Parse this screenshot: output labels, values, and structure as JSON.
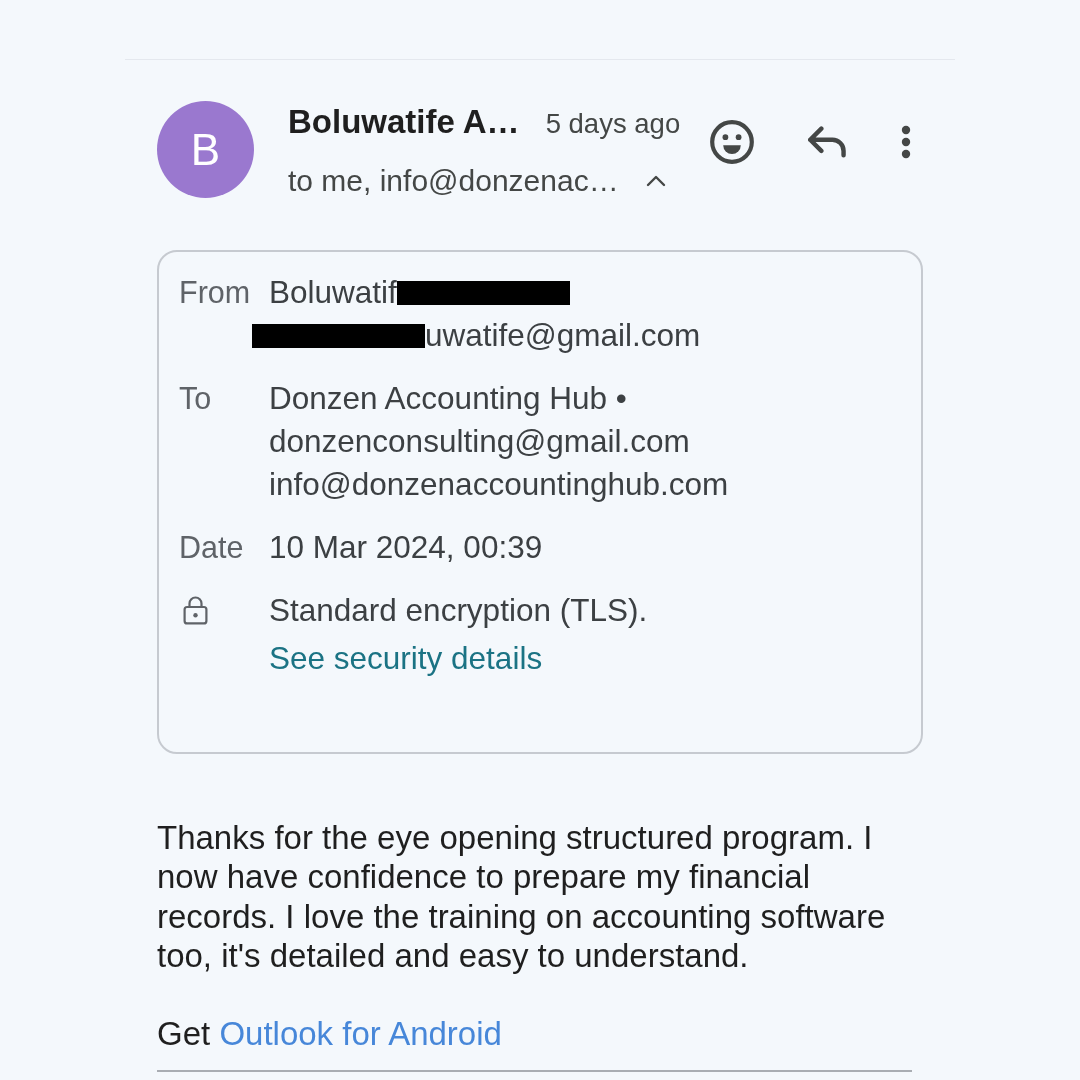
{
  "header": {
    "avatar_letter": "B",
    "sender": "Boluwatife A…",
    "time": "5 days ago",
    "recipients": "to me, info@donzenac…",
    "details_expanded": true
  },
  "details": {
    "rows": [
      {
        "kind": "field",
        "label": "From",
        "lines": [
          {
            "text": "Boluwatif",
            "redacted_start": false,
            "redacted_end": true
          },
          {
            "text": "uwatife@gmail.com",
            "redacted_start": true,
            "redacted_end": false
          }
        ]
      },
      {
        "kind": "field",
        "label": "To",
        "lines": [
          {
            "text": "Donzen Accounting Hub •",
            "redacted_start": false,
            "redacted_end": false
          },
          {
            "text": "donzenconsulting@gmail.com",
            "redacted_start": false,
            "redacted_end": false
          },
          {
            "text": "info@donzenaccountinghub.com",
            "redacted_start": false,
            "redacted_end": false
          }
        ]
      },
      {
        "kind": "field",
        "label": "Date",
        "lines": [
          {
            "text": "10 Mar 2024, 00:39",
            "redacted_start": false,
            "redacted_end": false
          }
        ]
      },
      {
        "kind": "security",
        "lines": [
          {
            "text": "Standard encryption (TLS).",
            "redacted_start": false,
            "redacted_end": false
          }
        ],
        "link": "See security details"
      }
    ]
  },
  "body": {
    "paragraph": "Thanks for the eye opening structured program. I now have confidence to prepare my financial records. I love the training on accounting software too, it's detailed and easy to understand.",
    "signature": {
      "prefix": "Get",
      "link": "Outlook for Android"
    }
  }
}
